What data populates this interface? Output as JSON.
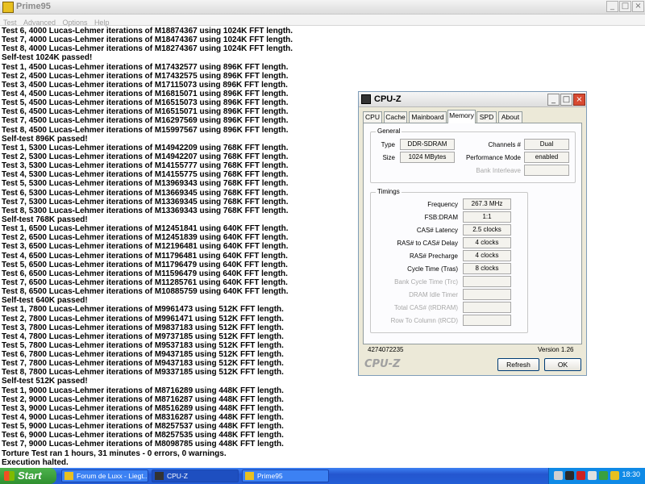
{
  "prime95": {
    "title": "Prime95",
    "menu": [
      "Test",
      "Advanced",
      "Options",
      "Help"
    ],
    "log": [
      "Test 6, 4000 Lucas-Lehmer iterations of M18874367 using 1024K FFT length.",
      "Test 7, 4000 Lucas-Lehmer iterations of M18474367 using 1024K FFT length.",
      "Test 8, 4000 Lucas-Lehmer iterations of M18274367 using 1024K FFT length.",
      "Self-test 1024K passed!",
      "Test 1, 4500 Lucas-Lehmer iterations of M17432577 using 896K FFT length.",
      "Test 2, 4500 Lucas-Lehmer iterations of M17432575 using 896K FFT length.",
      "Test 3, 4500 Lucas-Lehmer iterations of M17115073 using 896K FFT length.",
      "Test 4, 4500 Lucas-Lehmer iterations of M16815071 using 896K FFT length.",
      "Test 5, 4500 Lucas-Lehmer iterations of M16515073 using 896K FFT length.",
      "Test 6, 4500 Lucas-Lehmer iterations of M16515071 using 896K FFT length.",
      "Test 7, 4500 Lucas-Lehmer iterations of M16297569 using 896K FFT length.",
      "Test 8, 4500 Lucas-Lehmer iterations of M15997567 using 896K FFT length.",
      "Self-test 896K passed!",
      "Test 1, 5300 Lucas-Lehmer iterations of M14942209 using 768K FFT length.",
      "Test 2, 5300 Lucas-Lehmer iterations of M14942207 using 768K FFT length.",
      "Test 3, 5300 Lucas-Lehmer iterations of M14155777 using 768K FFT length.",
      "Test 4, 5300 Lucas-Lehmer iterations of M14155775 using 768K FFT length.",
      "Test 5, 5300 Lucas-Lehmer iterations of M13969343 using 768K FFT length.",
      "Test 6, 5300 Lucas-Lehmer iterations of M13669345 using 768K FFT length.",
      "Test 7, 5300 Lucas-Lehmer iterations of M13369345 using 768K FFT length.",
      "Test 8, 5300 Lucas-Lehmer iterations of M13369343 using 768K FFT length.",
      "Self-test 768K passed!",
      "Test 1, 6500 Lucas-Lehmer iterations of M12451841 using 640K FFT length.",
      "Test 2, 6500 Lucas-Lehmer iterations of M12451839 using 640K FFT length.",
      "Test 3, 6500 Lucas-Lehmer iterations of M12196481 using 640K FFT length.",
      "Test 4, 6500 Lucas-Lehmer iterations of M11796481 using 640K FFT length.",
      "Test 5, 6500 Lucas-Lehmer iterations of M11796479 using 640K FFT length.",
      "Test 6, 6500 Lucas-Lehmer iterations of M11596479 using 640K FFT length.",
      "Test 7, 6500 Lucas-Lehmer iterations of M11285761 using 640K FFT length.",
      "Test 8, 6500 Lucas-Lehmer iterations of M10885759 using 640K FFT length.",
      "Self-test 640K passed!",
      "Test 1, 7800 Lucas-Lehmer iterations of M9961473 using 512K FFT length.",
      "Test 2, 7800 Lucas-Lehmer iterations of M9961471 using 512K FFT length.",
      "Test 3, 7800 Lucas-Lehmer iterations of M9837183 using 512K FFT length.",
      "Test 4, 7800 Lucas-Lehmer iterations of M9737185 using 512K FFT length.",
      "Test 5, 7800 Lucas-Lehmer iterations of M9537183 using 512K FFT length.",
      "Test 6, 7800 Lucas-Lehmer iterations of M9437185 using 512K FFT length.",
      "Test 7, 7800 Lucas-Lehmer iterations of M9437183 using 512K FFT length.",
      "Test 8, 7800 Lucas-Lehmer iterations of M9337185 using 512K FFT length.",
      "Self-test 512K passed!",
      "Test 1, 9000 Lucas-Lehmer iterations of M8716289 using 448K FFT length.",
      "Test 2, 9000 Lucas-Lehmer iterations of M8716287 using 448K FFT length.",
      "Test 3, 9000 Lucas-Lehmer iterations of M8516289 using 448K FFT length.",
      "Test 4, 9000 Lucas-Lehmer iterations of M8316287 using 448K FFT length.",
      "Test 5, 9000 Lucas-Lehmer iterations of M8257537 using 448K FFT length.",
      "Test 6, 9000 Lucas-Lehmer iterations of M8257535 using 448K FFT length.",
      "Test 7, 9000 Lucas-Lehmer iterations of M8098785 using 448K FFT length.",
      "Torture Test ran 1 hours, 31 minutes - 0 errors, 0 warnings.",
      "Execution halted."
    ]
  },
  "cpuz": {
    "title": "CPU-Z",
    "tabs": [
      "CPU",
      "Cache",
      "Mainboard",
      "Memory",
      "SPD",
      "About"
    ],
    "active_tab": "Memory",
    "general": {
      "label": "General",
      "type_label": "Type",
      "type_value": "DDR-SDRAM",
      "size_label": "Size",
      "size_value": "1024 MBytes",
      "channels_label": "Channels #",
      "channels_value": "Dual",
      "perf_label": "Performance Mode",
      "perf_value": "enabled",
      "bank_label": "Bank Interleave"
    },
    "timings": {
      "label": "Timings",
      "rows": [
        {
          "label": "Frequency",
          "value": "267.3 MHz",
          "enabled": true
        },
        {
          "label": "FSB:DRAM",
          "value": "1:1",
          "enabled": true
        },
        {
          "label": "CAS# Latency",
          "value": "2.5 clocks",
          "enabled": true
        },
        {
          "label": "RAS# to CAS# Delay",
          "value": "4 clocks",
          "enabled": true
        },
        {
          "label": "RAS# Precharge",
          "value": "4 clocks",
          "enabled": true
        },
        {
          "label": "Cycle Time (Tras)",
          "value": "8 clocks",
          "enabled": true
        },
        {
          "label": "Bank Cycle Time (Trc)",
          "value": "",
          "enabled": false
        },
        {
          "label": "DRAM Idle Timer",
          "value": "",
          "enabled": false
        },
        {
          "label": "Total CAS# (tRDRAM)",
          "value": "",
          "enabled": false
        },
        {
          "label": "Row To Column (tRCD)",
          "value": "",
          "enabled": false
        }
      ]
    },
    "id_number": "4274072235",
    "version": "Version 1.26",
    "brand": "CPU-Z",
    "refresh_label": "Refresh",
    "ok_label": "OK"
  },
  "taskbar": {
    "start_label": "Start",
    "tasks": [
      "Forum de Luxx - Liegt...",
      "CPU-Z",
      "Prime95"
    ],
    "clock": "18:30"
  }
}
